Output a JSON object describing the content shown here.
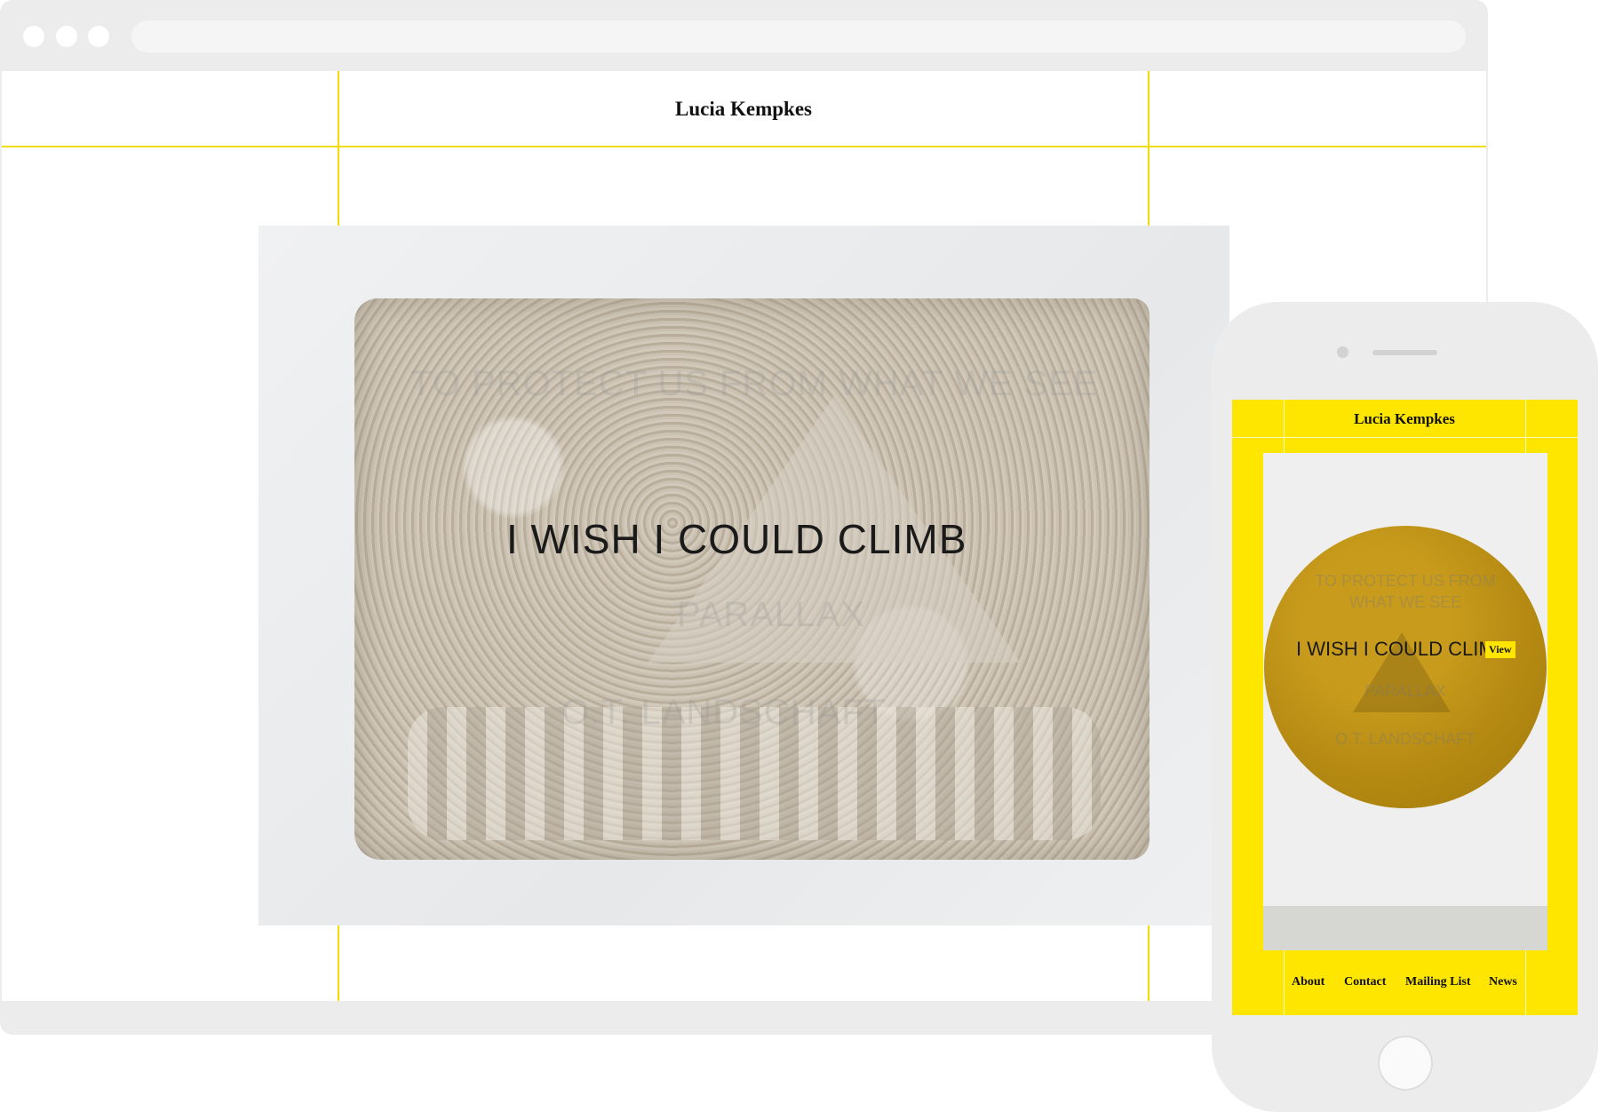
{
  "desktop": {
    "site_title": "Lucia Kempkes",
    "hero_menu": {
      "faint_top": "TO PROTECT US FROM WHAT WE SEE",
      "active": "I WISH I COULD CLIMB",
      "faint_mid": "PARALLAX",
      "faint_bottom": "O.T. LANDSCHAFT"
    }
  },
  "mobile": {
    "site_title": "Lucia Kempkes",
    "hero_menu": {
      "faint_1": "TO PROTECT US FROM",
      "faint_2": "WHAT WE SEE",
      "active": "I WISH I COULD CLIMB",
      "view_label": "View",
      "faint_3": "PARALLAX",
      "faint_4": "O.T. LANDSCHAFT"
    },
    "nav": [
      "About",
      "Contact",
      "Mailing List",
      "News"
    ]
  },
  "colors": {
    "accent": "#ffe600",
    "grid_line": "#f2dd00",
    "frame": "#ececec"
  }
}
